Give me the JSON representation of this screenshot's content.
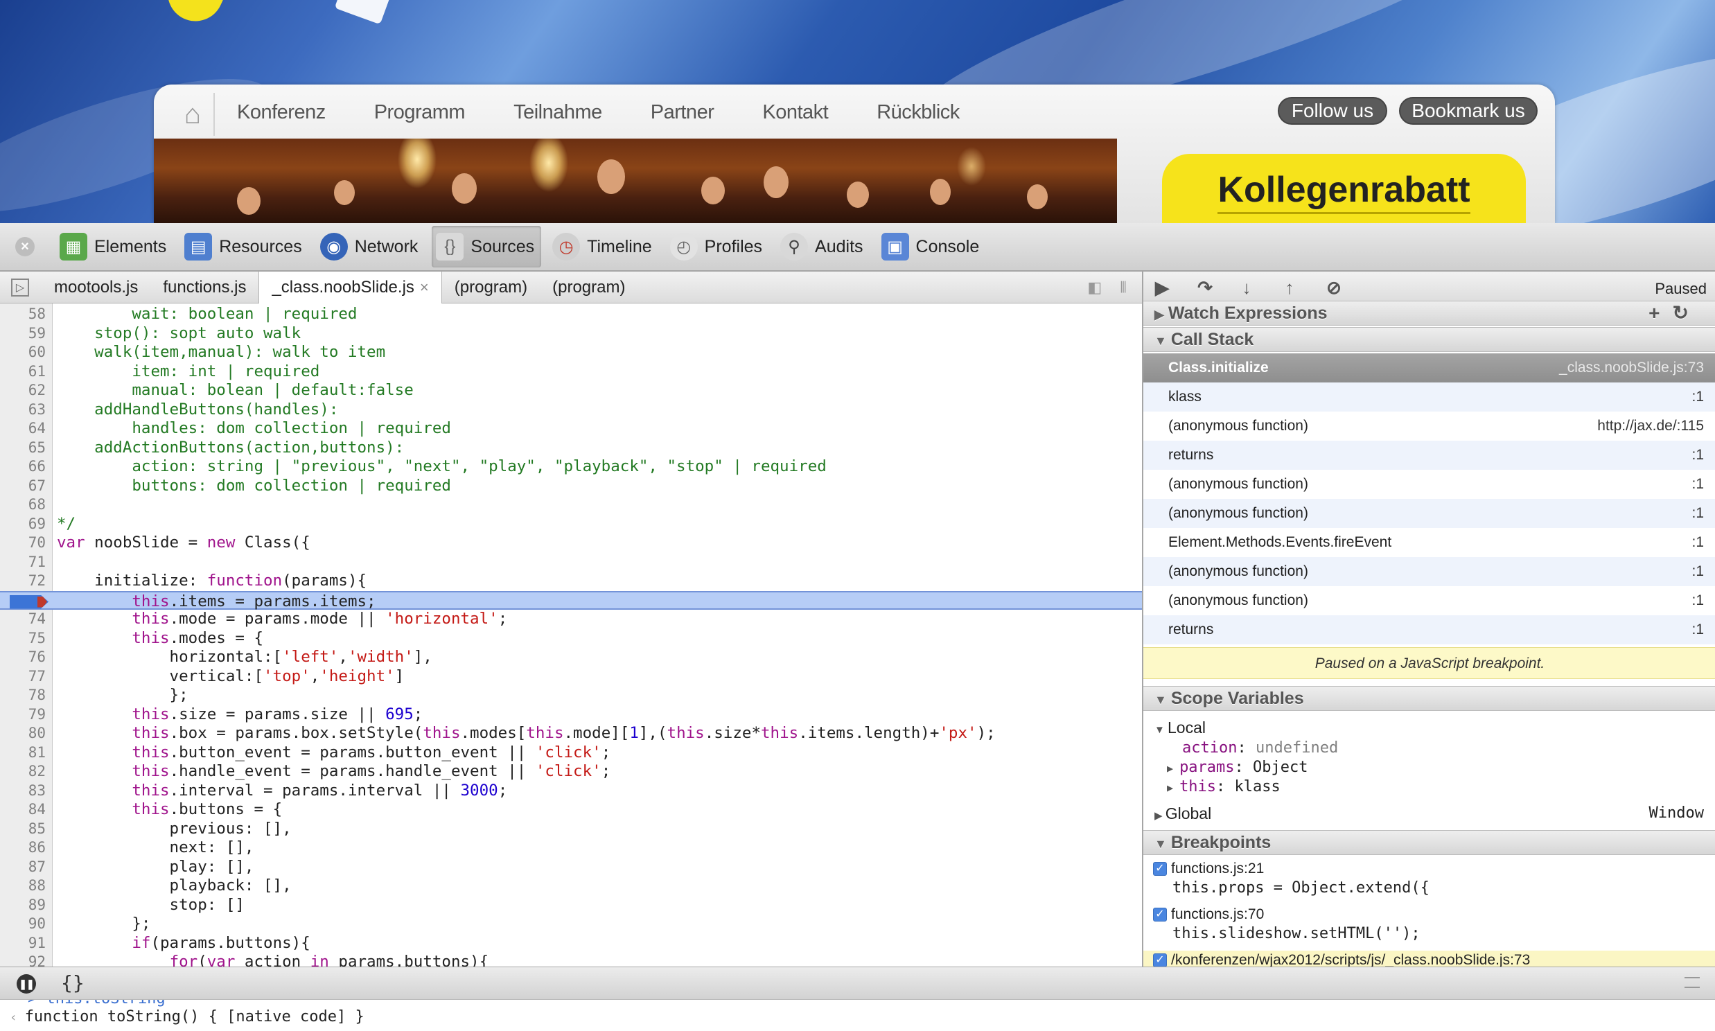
{
  "site": {
    "nav": [
      "Konferenz",
      "Programm",
      "Teilnahme",
      "Partner",
      "Kontakt",
      "Rückblick"
    ],
    "follow_label": "Follow us",
    "bookmark_label": "Bookmark us",
    "promo": "Kollegenrabatt"
  },
  "toolbar": {
    "items": [
      "Elements",
      "Resources",
      "Network",
      "Sources",
      "Timeline",
      "Profiles",
      "Audits",
      "Console"
    ],
    "active": "Sources"
  },
  "file_tabs": [
    "mootools.js",
    "functions.js",
    "_class.noobSlide.js",
    "(program)",
    "(program)"
  ],
  "code_lines": [
    {
      "n": "58",
      "t": "        wait: boolean | required"
    },
    {
      "n": "59",
      "t": "    stop(): sopt auto walk"
    },
    {
      "n": "60",
      "t": "    walk(item,manual): walk to item"
    },
    {
      "n": "61",
      "t": "        item: int | required"
    },
    {
      "n": "62",
      "t": "        manual: bolean | default:false"
    },
    {
      "n": "63",
      "t": "    addHandleButtons(handles):"
    },
    {
      "n": "64",
      "t": "        handles: dom collection | required"
    },
    {
      "n": "65",
      "t": "    addActionButtons(action,buttons):"
    },
    {
      "n": "66",
      "t": "        action: string | \"previous\", \"next\", \"play\", \"playback\", \"stop\" | required"
    },
    {
      "n": "67",
      "t": "        buttons: dom collection | required"
    },
    {
      "n": "68",
      "t": ""
    },
    {
      "n": "69",
      "t": "*/"
    },
    {
      "n": "70",
      "t": "var noobSlide = new Class({"
    },
    {
      "n": "71",
      "t": ""
    },
    {
      "n": "72",
      "t": "    initialize: function(params){"
    },
    {
      "n": "73",
      "t": "        this.items = params.items;"
    },
    {
      "n": "74",
      "t": "        this.mode = params.mode || 'horizontal';"
    },
    {
      "n": "75",
      "t": "        this.modes = {"
    },
    {
      "n": "76",
      "t": "            horizontal:['left','width'],"
    },
    {
      "n": "77",
      "t": "            vertical:['top','height']"
    },
    {
      "n": "78",
      "t": "            };"
    },
    {
      "n": "79",
      "t": "        this.size = params.size || 695;"
    },
    {
      "n": "80",
      "t": "        this.box = params.box.setStyle(this.modes[this.mode][1],(this.size*this.items.length)+'px');"
    },
    {
      "n": "81",
      "t": "        this.button_event = params.button_event || 'click';"
    },
    {
      "n": "82",
      "t": "        this.handle_event = params.handle_event || 'click';"
    },
    {
      "n": "83",
      "t": "        this.interval = params.interval || 3000;"
    },
    {
      "n": "84",
      "t": "        this.buttons = {"
    },
    {
      "n": "85",
      "t": "            previous: [],"
    },
    {
      "n": "86",
      "t": "            next: [],"
    },
    {
      "n": "87",
      "t": "            play: [],"
    },
    {
      "n": "88",
      "t": "            playback: [],"
    },
    {
      "n": "89",
      "t": "            stop: []"
    },
    {
      "n": "90",
      "t": "        };"
    },
    {
      "n": "91",
      "t": "        if(params.buttons){"
    },
    {
      "n": "92",
      "t": "            for(var action in params.buttons){"
    }
  ],
  "debugger": {
    "paused": "Paused",
    "watch_header": "Watch Expressions",
    "callstack_header": "Call Stack",
    "callstack": [
      {
        "fn": "Class.initialize",
        "loc": "_class.noobSlide.js:73"
      },
      {
        "fn": "klass",
        "loc": ":1"
      },
      {
        "fn": "(anonymous function)",
        "loc": "http://jax.de/:115"
      },
      {
        "fn": "returns",
        "loc": ":1"
      },
      {
        "fn": "(anonymous function)",
        "loc": ":1"
      },
      {
        "fn": "(anonymous function)",
        "loc": ":1"
      },
      {
        "fn": "Element.Methods.Events.fireEvent",
        "loc": ":1"
      },
      {
        "fn": "(anonymous function)",
        "loc": ":1"
      },
      {
        "fn": "(anonymous function)",
        "loc": ":1"
      },
      {
        "fn": "returns",
        "loc": ":1"
      }
    ],
    "paused_message": "Paused on a JavaScript breakpoint.",
    "scope_header": "Scope Variables",
    "scope_local": "Local",
    "scope_vars": [
      {
        "key": "action",
        "val": "undefined"
      },
      {
        "key": "params",
        "val": "Object"
      },
      {
        "key": "this",
        "val": "klass"
      }
    ],
    "scope_global": "Global",
    "scope_global_val": "Window",
    "breakpoints_header": "Breakpoints",
    "breakpoints": [
      {
        "file": "functions.js:21",
        "code": "this.props = Object.extend({"
      },
      {
        "file": "functions.js:70",
        "code": "this.slideshow.setHTML('');"
      },
      {
        "file": "/konferenzen/wjax2012/scripts/js/_class.noobSlide.js:73",
        "code": ""
      }
    ]
  },
  "console": {
    "prev": "> this.toString",
    "result": "function toString() { [native code] }"
  },
  "colors": {
    "keyword": "#a0148c",
    "comment": "#237a23",
    "string": "#c41a16",
    "number": "#1c00cf",
    "highlight": "#b6cdf6"
  }
}
